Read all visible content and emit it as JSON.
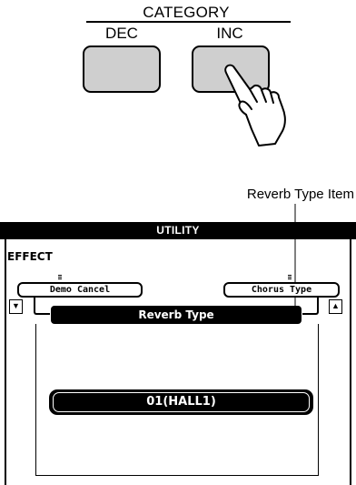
{
  "panel": {
    "category_label": "CATEGORY",
    "dec_label": "DEC",
    "inc_label": "INC"
  },
  "callout": {
    "text": "Reverb Type Item"
  },
  "display": {
    "title": "UTILITY",
    "section_label": "EFFECT",
    "prev_item": "Demo Cancel",
    "next_item": "Chorus Type",
    "current_item": "Reverb Type",
    "current_value": "01(HALL1)",
    "scroll_down_glyph": "▼",
    "scroll_up_glyph": "▲"
  },
  "colors": {
    "button_fill": "#cfcfcf",
    "display_dark": "#000000",
    "display_light": "#ffffff"
  },
  "icons": [
    "pressing-hand-icon",
    "scroll-down-icon",
    "scroll-up-icon"
  ]
}
